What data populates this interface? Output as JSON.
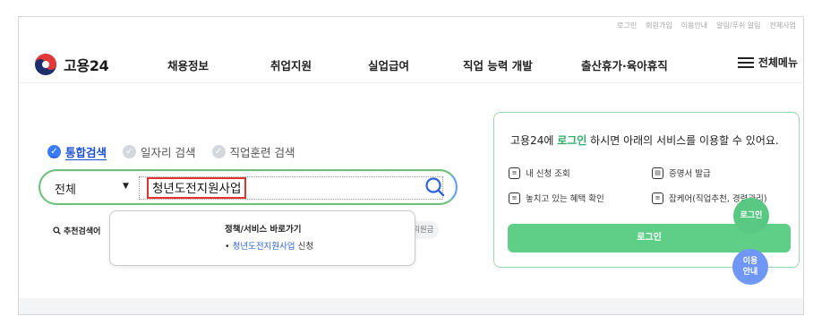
{
  "util_links": [
    "로그인",
    "회원가입",
    "이용안내",
    "알림/푸쉬 알림",
    "전체사업"
  ],
  "header": {
    "logo_text": "고용24",
    "nav": [
      "채용정보",
      "취업지원",
      "실업급여",
      "직업 능력 개발",
      "출산휴가·육아휴직"
    ],
    "all_menu": "전체메뉴"
  },
  "search": {
    "tabs": [
      "통합검색",
      "일자리 검색",
      "직업훈련 검색"
    ],
    "category": "전체",
    "query": "청년도전지원사업",
    "recommended_label": "추천검색어",
    "hidden_chip": "워원금"
  },
  "dropdown": {
    "title": "정책/서비스 바로가기",
    "link": "청년도전지원사업",
    "link_suffix": "신청"
  },
  "login_panel": {
    "message_pre": "고용24에 ",
    "message_hl": "로그인",
    "message_post": " 하시면 아래의 서비스를 이용할 수 있어요.",
    "services": [
      "내 신청 조회",
      "증명서 발급",
      "놓치고 있는 혜택 확인",
      "잡케어(직업추천, 경력관리)"
    ],
    "login_button": "로그인"
  },
  "floating": {
    "login": "로그인",
    "guide_line1": "이용",
    "guide_line2": "안내"
  },
  "colors": {
    "accent_green": "#5fcf87",
    "accent_blue": "#3a7bff",
    "highlight_red": "#e0322f"
  }
}
